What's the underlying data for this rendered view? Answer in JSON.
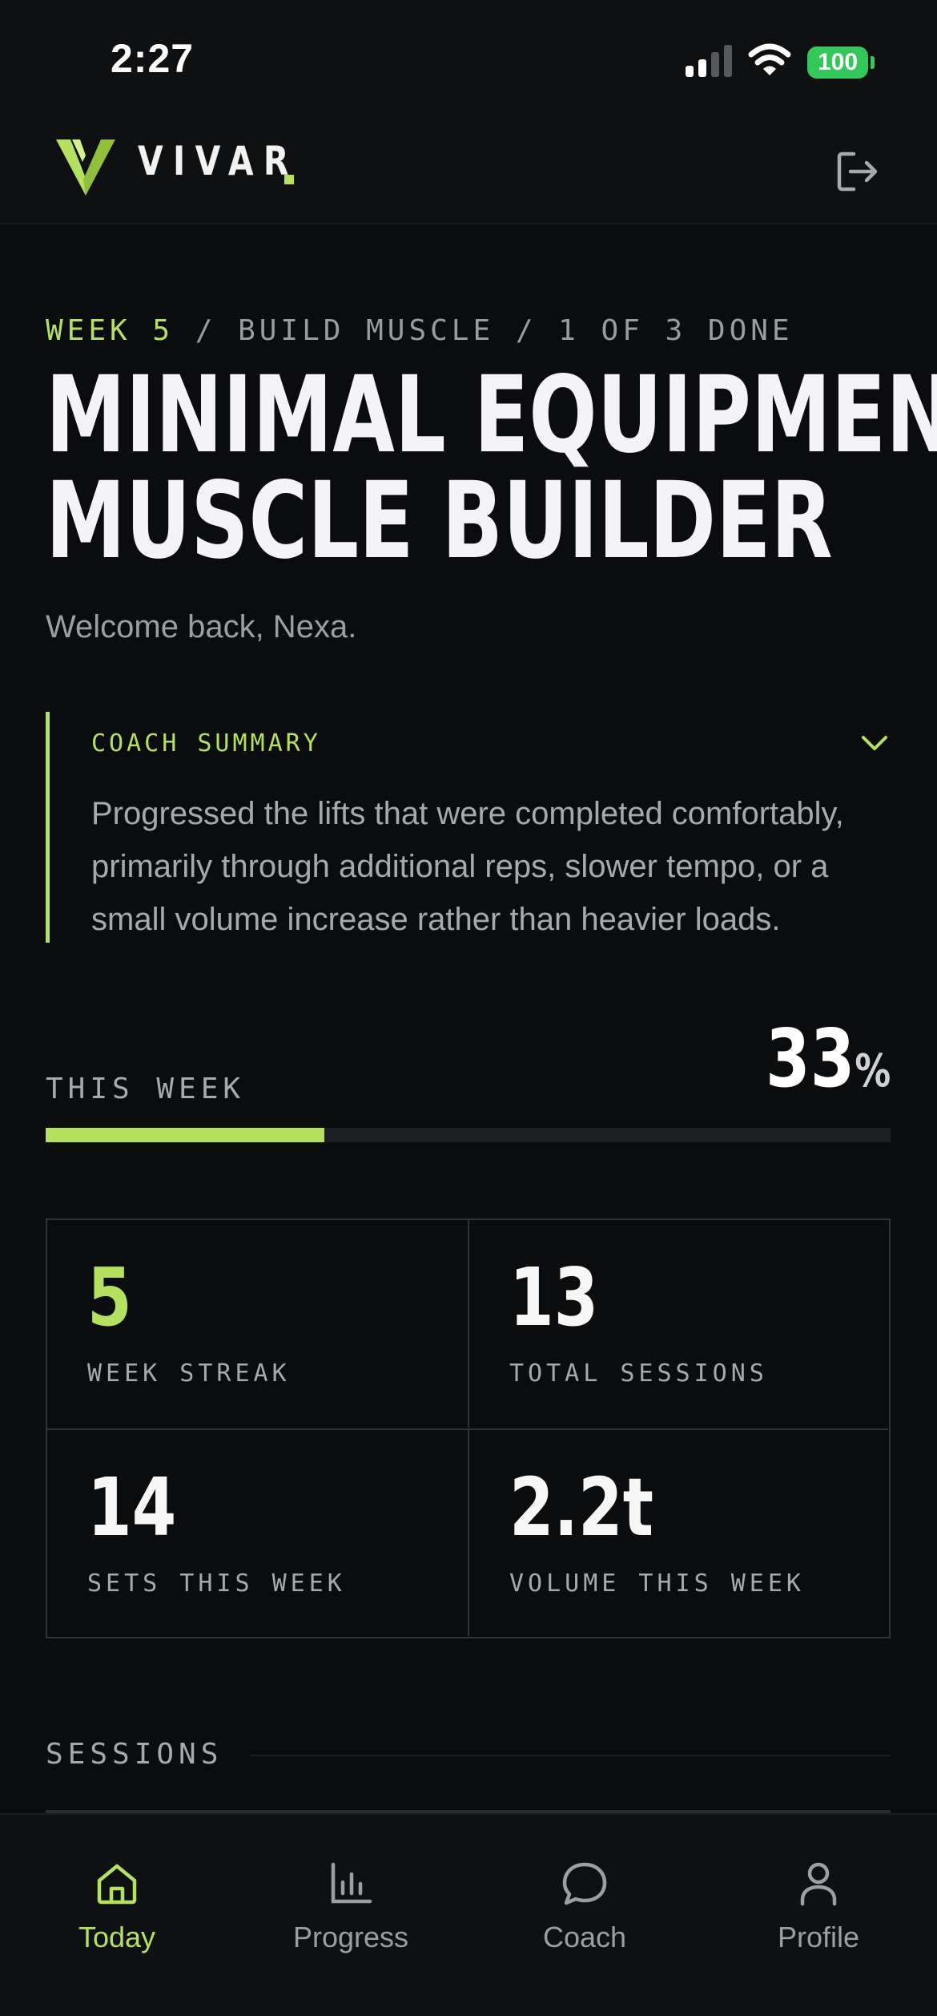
{
  "status_bar": {
    "time": "2:27",
    "battery": "100",
    "icons": [
      "signal-icon",
      "wifi-icon",
      "battery-icon"
    ]
  },
  "header": {
    "brand": "VIVAR",
    "logo_icon": "vivar-logo-icon",
    "logout_icon": "logout-icon"
  },
  "workout": {
    "week": "WEEK 5",
    "crumb_rest": " / BUILD MUSCLE / 1 OF 3 DONE",
    "title_line1": "MINIMAL EQUIPMENT",
    "title_line2": "MUSCLE BUILDER",
    "welcome": "Welcome back, Nexa."
  },
  "coach_summary": {
    "label": "COACH SUMMARY",
    "text": "Progressed the lifts that were completed comfortably, primarily through additional reps, slower tempo, or a small volume increase rather than heavier loads.",
    "expand_icon": "chevron-down-icon"
  },
  "this_week": {
    "label": "THIS WEEK",
    "percent": "33",
    "unit": "%",
    "progress_fraction": 0.33
  },
  "stats": [
    {
      "value": "5",
      "label": "WEEK STREAK",
      "highlight": true
    },
    {
      "value": "13",
      "label": "TOTAL SESSIONS",
      "highlight": false
    },
    {
      "value": "14",
      "label": "SETS THIS WEEK",
      "highlight": false
    },
    {
      "value": "2.2t",
      "label": "VOLUME THIS WEEK",
      "highlight": false
    }
  ],
  "sessions": {
    "label": "SESSIONS"
  },
  "tabs": [
    {
      "label": "Today",
      "icon": "home-icon",
      "active": true
    },
    {
      "label": "Progress",
      "icon": "bar-chart-icon",
      "active": false
    },
    {
      "label": "Coach",
      "icon": "chat-bubble-icon",
      "active": false
    },
    {
      "label": "Profile",
      "icon": "person-icon",
      "active": false
    }
  ],
  "colors": {
    "accent": "#b5e160",
    "background": "#0b0c0e",
    "muted_text": "#a7a9ad"
  }
}
